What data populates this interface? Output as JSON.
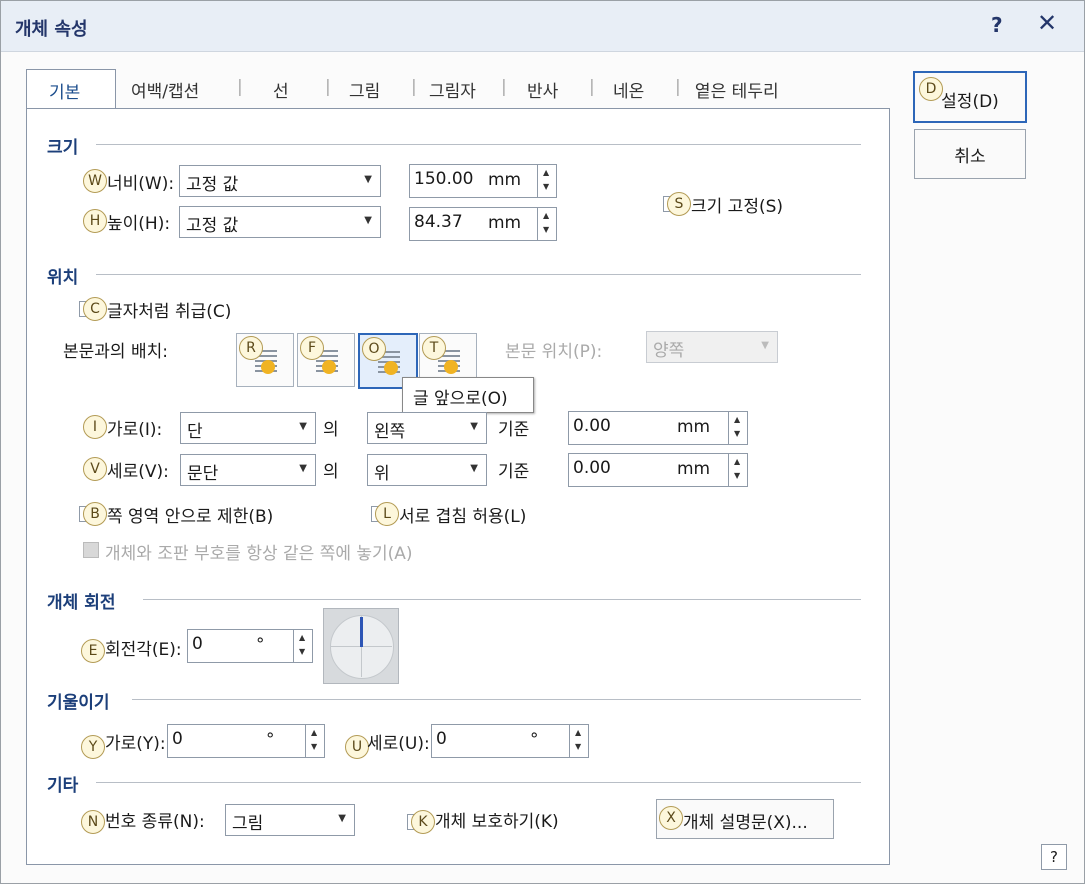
{
  "window": {
    "title": "개체 속성",
    "help": "?",
    "close": "✕"
  },
  "tabs": [
    "기본",
    "여백/캡션",
    "선",
    "그림",
    "그림자",
    "반사",
    "네온",
    "옅은 테두리"
  ],
  "tab_separators": "|",
  "buttons": {
    "ok": "설정(D)",
    "ok_badge": "D",
    "cancel": "취소"
  },
  "size": {
    "heading": "크기",
    "width_label": "너비(W):",
    "width_badge": "W",
    "width_mode": "고정 값",
    "width_value": "150.00",
    "width_unit": "mm",
    "height_label": "높이(H):",
    "height_badge": "H",
    "height_mode": "고정 값",
    "height_value": "84.37",
    "height_unit": "mm",
    "lock_label": "크기 고정(S)",
    "lock_badge": "S"
  },
  "position": {
    "heading": "위치",
    "as_char_label": "글자처럼 취급(C)",
    "as_char_badge": "C",
    "wrap_label": "본문과의 배치:",
    "wrap_badges": [
      "R",
      "F",
      "O",
      "T"
    ],
    "body_pos_label": "본문 위치(P):",
    "body_pos_value": "양쪽",
    "tooltip": "글 앞으로(O)",
    "horiz_label": "가로(I):",
    "horiz_badge": "I",
    "horiz_ref": "단",
    "of": "의",
    "horiz_align": "왼쪽",
    "basis": "기준",
    "horiz_offset": "0.00",
    "unit": "mm",
    "vert_label": "세로(V):",
    "vert_badge": "V",
    "vert_ref": "문단",
    "vert_align": "위",
    "vert_offset": "0.00",
    "limit_label": "쪽 영역 안으로 제한(B)",
    "limit_badge": "B",
    "overlap_label": "서로 겹침 허용(L)",
    "overlap_badge": "L",
    "keep_label": "개체와 조판 부호를 항상 같은 쪽에 놓기(A)"
  },
  "rotation": {
    "heading": "개체 회전",
    "label": "회전각(E):",
    "badge": "E",
    "value": "0",
    "unit": "°"
  },
  "skew": {
    "heading": "기울이기",
    "x_label": "가로(Y):",
    "x_badge": "Y",
    "x_value": "0",
    "y_label": "세로(U):",
    "y_badge": "U",
    "y_value": "0",
    "unit": "°"
  },
  "etc": {
    "heading": "기타",
    "type_label": "번호 종류(N):",
    "type_badge": "N",
    "type_value": "그림",
    "protect_label": "개체 보호하기(K)",
    "protect_badge": "K",
    "desc_button": "개체 설명문(X)...",
    "desc_badge": "X"
  },
  "corner_help": "?"
}
